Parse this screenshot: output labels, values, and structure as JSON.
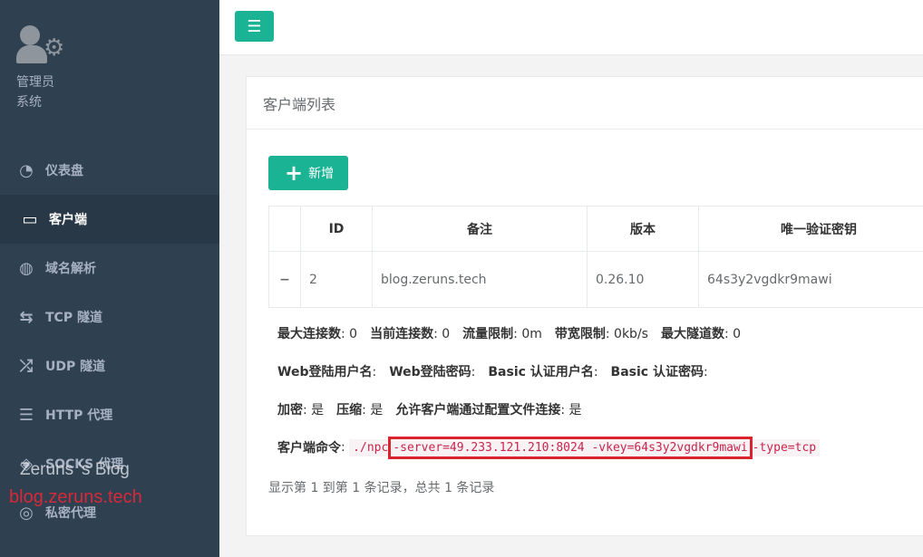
{
  "sidebar": {
    "profile_name": "管理员",
    "profile_role": "系统",
    "items": [
      {
        "label": "仪表盘",
        "icon": "dashboard-icon",
        "glyph": "◔"
      },
      {
        "label": "客户端",
        "icon": "monitor-icon",
        "glyph": "▭"
      },
      {
        "label": "域名解析",
        "icon": "globe-icon",
        "glyph": "◍"
      },
      {
        "label": "TCP 隧道",
        "icon": "exchange-icon",
        "glyph": "⇆"
      },
      {
        "label": "UDP 隧道",
        "icon": "random-icon",
        "glyph": "⤮"
      },
      {
        "label": "HTTP 代理",
        "icon": "server-icon",
        "glyph": "☰"
      },
      {
        "label": "SOCKS 代理",
        "icon": "layers-icon",
        "glyph": "◈"
      },
      {
        "label": "私密代理",
        "icon": "eye-slash-icon",
        "glyph": "◎"
      }
    ],
    "watermark_title": "Zeruns 's Blog",
    "watermark_url": "blog.zeruns.tech"
  },
  "topbar": {
    "menu_glyph": "☰"
  },
  "panel": {
    "title": "客户端列表",
    "add_button": "新增",
    "add_glyph": "+",
    "columns": [
      "",
      "ID",
      "备注",
      "版本",
      "唯一验证密钥"
    ],
    "row": {
      "toggle": "−",
      "id": "2",
      "remark": "blog.zeruns.tech",
      "version": "0.26.10",
      "vkey": "64s3y2vgdkr9mawi"
    },
    "detail": {
      "max_conn_label": "最大连接数",
      "max_conn": ": 0",
      "cur_conn_label": "当前连接数",
      "cur_conn": ": 0",
      "flow_label": "流量限制",
      "flow": ": 0m",
      "bw_label": "带宽限制",
      "bw": ": 0kb/s",
      "max_tunnel_label": "最大隧道数",
      "max_tunnel": ": 0",
      "web_user_label": "Web登陆用户名",
      "web_user": ":",
      "web_pass_label": "Web登陆密码",
      "web_pass": ":",
      "basic_user_label": "Basic 认证用户名",
      "basic_user": ":",
      "basic_pass_label": "Basic 认证密码",
      "basic_pass": ":",
      "crypt_label": "加密",
      "crypt": ": 是",
      "compress_label": "压缩",
      "compress": ": 是",
      "config_label": "允许客户端通过配置文件连接",
      "config": ": 是",
      "cmd_label": "客户端命令",
      "cmd_prefix": "./npc",
      "cmd_highlight": "-server=49.233.121.210:8024 -vkey=64s3y2vgdkr9mawi",
      "cmd_suffix": "-type=tcp"
    },
    "footer": "显示第 1 到第 1 条记录，总共 1 条记录"
  }
}
